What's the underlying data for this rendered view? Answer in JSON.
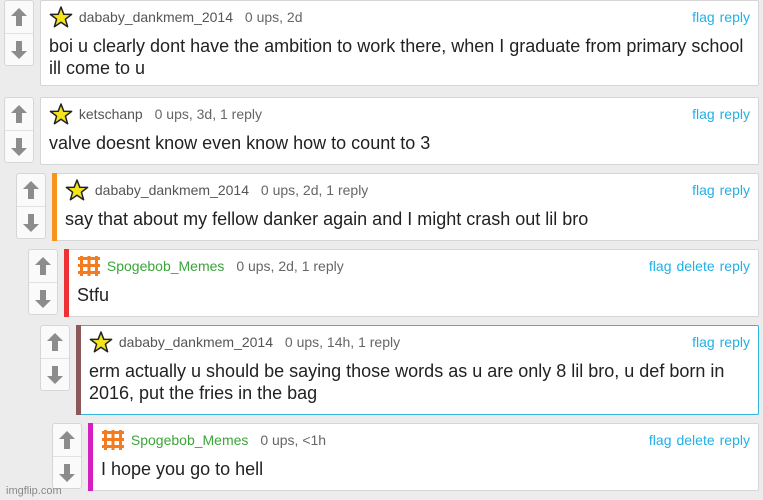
{
  "comments": [
    {
      "username": "dababy_dankmem_2014",
      "stats": "0 ups, 2d",
      "avatar": "star-icon",
      "text": "boi u clearly dont have the ambition to work there, when I graduate from primary school ill come to u",
      "actions": [
        "flag",
        "reply"
      ]
    },
    {
      "username": "ketschanp",
      "stats": "0 ups, 3d, 1 reply",
      "avatar": "star-icon",
      "text": "valve doesnt know even know how to count to 3",
      "actions": [
        "flag",
        "reply"
      ]
    },
    {
      "username": "dababy_dankmem_2014",
      "stats": "0 ups, 2d, 1 reply",
      "avatar": "star-icon",
      "text": "say that about my fellow danker again and I might crash out lil bro",
      "actions": [
        "flag",
        "reply"
      ],
      "accent_color": "#f7941d"
    },
    {
      "username": "Spogebob_Memes",
      "stats": "0 ups, 2d, 1 reply",
      "avatar": "grid-avatar-icon",
      "text": "Stfu",
      "actions": [
        "flag",
        "delete",
        "reply"
      ],
      "accent_color": "#ed3237"
    },
    {
      "username": "dababy_dankmem_2014",
      "stats": "0 ups, 14h, 1 reply",
      "avatar": "star-icon",
      "text": "erm actually u should be saying those words as u are only 8 lil bro, u def born in 2016, put the fries in the bag",
      "actions": [
        "flag",
        "reply"
      ],
      "accent_color": "#8a5a5a"
    },
    {
      "username": "Spogebob_Memes",
      "stats": "0 ups, <1h",
      "avatar": "grid-avatar-icon",
      "text": "I hope you go to hell",
      "actions": [
        "flag",
        "delete",
        "reply"
      ],
      "accent_color": "#d61fc0"
    }
  ],
  "watermark": "imgflip.com",
  "colors": {
    "link": "#1fb1e6",
    "username_green": "#3ba53b",
    "background": "#ececec"
  }
}
